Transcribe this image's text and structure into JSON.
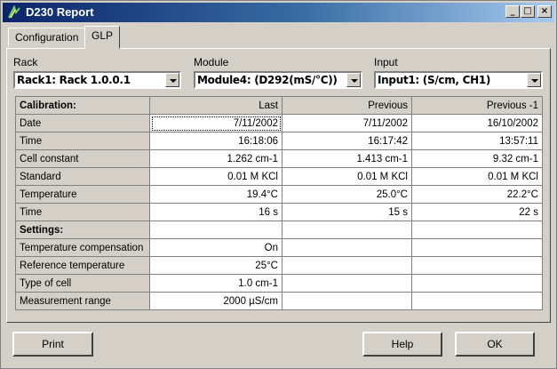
{
  "window": {
    "title": "D230 Report"
  },
  "titlebar": {
    "minimize": "_",
    "maximize": "□",
    "close": "×"
  },
  "tabs": [
    {
      "label": "Configuration"
    },
    {
      "label": "GLP"
    }
  ],
  "selectors": {
    "rack": {
      "label": "Rack",
      "value": "Rack1: Rack 1.0.0.1"
    },
    "module": {
      "label": "Module",
      "value": "Module4: (D292(mS/°C))"
    },
    "input": {
      "label": "Input",
      "value": "Input1: (S/cm, CH1)"
    }
  },
  "table": {
    "columns": [
      "Calibration:",
      "Last",
      "Previous",
      "Previous -1"
    ],
    "calibration_rows": [
      {
        "label": "Date",
        "values": [
          "7/11/2002",
          "7/11/2002",
          "16/10/2002"
        ]
      },
      {
        "label": "Time",
        "values": [
          "16:18:06",
          "16:17:42",
          "13:57:11"
        ]
      },
      {
        "label": "Cell constant",
        "values": [
          "1.262 cm-1",
          "1.413 cm-1",
          "9.32 cm-1"
        ]
      },
      {
        "label": "Standard",
        "values": [
          "0.01 M KCl",
          "0.01 M KCl",
          "0.01 M KCl"
        ]
      },
      {
        "label": "Temperature",
        "values": [
          "19.4°C",
          "25.0°C",
          "22.2°C"
        ]
      },
      {
        "label": "Time",
        "values": [
          "16 s",
          "15 s",
          "22 s"
        ]
      }
    ],
    "settings_header": "Settings:",
    "settings_rows": [
      {
        "label": "Temperature compensation",
        "values": [
          "On",
          "",
          ""
        ]
      },
      {
        "label": "Reference temperature",
        "values": [
          "25°C",
          "",
          ""
        ]
      },
      {
        "label": "Type of cell",
        "values": [
          "1.0 cm-1",
          "",
          ""
        ]
      },
      {
        "label": "Measurement range",
        "values": [
          "2000 µS/cm",
          "",
          ""
        ]
      }
    ]
  },
  "buttons": {
    "print": "Print",
    "help": "Help",
    "ok": "OK"
  }
}
